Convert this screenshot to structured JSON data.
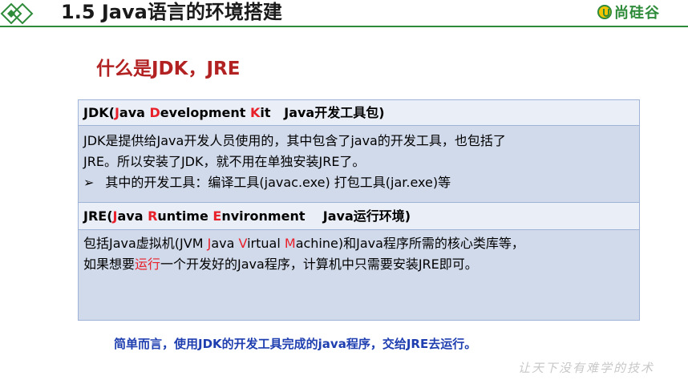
{
  "header": {
    "title": "1.5 Java语言的环境搭建",
    "logo_text": "尚硅谷",
    "colors": {
      "accent": "#2e8b3a",
      "logo_yellow": "#f3c500"
    }
  },
  "section_title": "什么是JDK，JRE",
  "jdk": {
    "heading": {
      "p1": "JDK(",
      "j": "J",
      "p2": "ava ",
      "d": "D",
      "p3": "evelopment ",
      "k": "K",
      "p4": "it   Java开发工具包)"
    },
    "line1": "JDK是提供给Java开发人员使用的，其中包含了java的开发工具，也包括了",
    "line2": "JRE。所以安装了JDK，就不用在单独安装JRE了。",
    "bullet_symbol": "➢",
    "bullet_text": "其中的开发工具：编译工具(javac.exe)  打包工具(jar.exe)等"
  },
  "jre": {
    "heading": {
      "p1": "JRE(",
      "j": "J",
      "p2": "ava ",
      "r": "R",
      "p3": "untime ",
      "e": "E",
      "p4": "nvironment    Java运行环境)"
    },
    "line1": {
      "p1": "包括Java虚拟机(JVM ",
      "j": "J",
      "p2": "ava ",
      "v": "V",
      "p3": "irtual ",
      "m": "M",
      "p4": "achine)和Java程序所需的核心类库等，"
    },
    "line2": {
      "p1": "如果想要",
      "run": "运行",
      "p2": "一个开发好的Java程序，计算机中只需要安装JRE即可。"
    }
  },
  "summary": "简单而言，使用JDK的开发工具完成的java程序，交给JRE去运行。",
  "watermark": "让天下没有难学的技术"
}
